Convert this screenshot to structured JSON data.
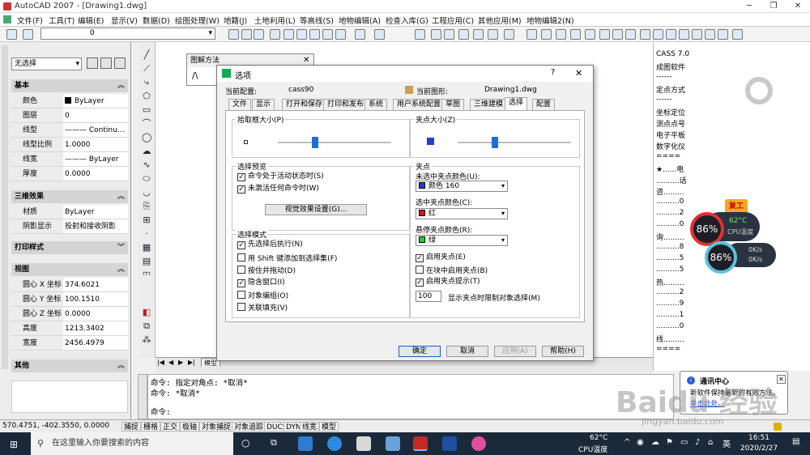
{
  "app": {
    "title": "AutoCAD 2007 - [Drawing1.dwg]"
  },
  "menu": [
    "文件(F)",
    "工具(T)",
    "编辑(E)",
    "显示(V)",
    "数据(D)",
    "绘图处理(W)",
    "地籍(J)",
    "土地利用(L)",
    "等高线(S)",
    "地物编辑(A)",
    "检查入库(G)",
    "工程应用(C)",
    "其他应用(M)",
    "地物编辑2(N)"
  ],
  "layer": {
    "value": "0"
  },
  "properties": {
    "selection": "无选择",
    "sections": {
      "basic": "基本",
      "threed": "三维效果",
      "print": "打印样式",
      "view": "视图",
      "other": "其他"
    },
    "basic_rows": [
      {
        "k": "颜色",
        "v": "ByLayer"
      },
      {
        "k": "图层",
        "v": "0"
      },
      {
        "k": "线型",
        "v": "——— Continu…"
      },
      {
        "k": "线型比例",
        "v": "1.0000"
      },
      {
        "k": "线宽",
        "v": "——— ByLayer"
      },
      {
        "k": "厚度",
        "v": "0.0000"
      }
    ],
    "threed_rows": [
      {
        "k": "材质",
        "v": "ByLayer"
      },
      {
        "k": "阴影显示",
        "v": "投射和接收阴影"
      }
    ],
    "view_rows": [
      {
        "k": "圆心 X 坐标",
        "v": "374.6021"
      },
      {
        "k": "圆心 Y 坐标",
        "v": "100.1510"
      },
      {
        "k": "圆心 Z 坐标",
        "v": "0.0000"
      },
      {
        "k": "高度",
        "v": "1213.3402"
      },
      {
        "k": "宽度",
        "v": "2456.4979"
      }
    ]
  },
  "tujie": {
    "title": "图解方法"
  },
  "dialog": {
    "title": "选项",
    "profile_label": "当前配置:",
    "profile": "cass90",
    "drawing_label": "当前图形:",
    "drawing": "Drawing1.dwg",
    "tabs": [
      "文件",
      "显示",
      "打开和保存",
      "打印和发布",
      "系统",
      "用户系统配置",
      "草图",
      "三维建模",
      "选择",
      "配置"
    ],
    "pickbox": {
      "title": "拾取框大小(P)",
      "level": 0.33
    },
    "gripsize": {
      "title": "夹点大小(Z)",
      "level": 0.33
    },
    "preview": {
      "title": "选择预览",
      "opt1": "命令处于活动状态时(S)",
      "opt2": "未激活任何命令时(W)",
      "button": "视觉效果设置(G)..."
    },
    "mode": {
      "title": "选择模式",
      "items": [
        {
          "label": "先选择后执行(N)",
          "checked": true
        },
        {
          "label": "用 Shift 键添加到选择集(F)",
          "checked": false
        },
        {
          "label": "按住并拖动(D)",
          "checked": false
        },
        {
          "label": "隐含窗口(I)",
          "checked": true
        },
        {
          "label": "对象编组(O)",
          "checked": false
        },
        {
          "label": "关联填充(V)",
          "checked": false
        }
      ]
    },
    "grips": {
      "title": "夹点",
      "unsel_label": "未选中夹点颜色(U):",
      "unsel": "颜色 160",
      "unsel_color": "#1f3fd0",
      "sel_label": "选中夹点颜色(C):",
      "sel": "红",
      "sel_color": "#e01010",
      "hover_label": "悬停夹点颜色(R):",
      "hover": "绿",
      "hover_color": "#20d020",
      "enable": "启用夹点(E)",
      "block": "在块中启用夹点(B)",
      "tips": "启用夹点提示(T)",
      "limit_value": "100",
      "limit_label": "显示夹点时限制对象选择(M)"
    },
    "buttons": {
      "ok": "确定",
      "cancel": "取消",
      "apply": "应用(A)",
      "help": "帮助(H)"
    }
  },
  "right_panel": {
    "header": "CASS 7.0",
    "items": [
      "成图软件",
      "------",
      "定点方式",
      "------",
      "坐标定位",
      "测点点号",
      "电子平板",
      "数字化仪",
      "====",
      "★......电",
      "..........话",
      "咨.........",
      "..........0",
      "..........2",
      "..........0",
      "询.........",
      "..........8",
      "..........5",
      "..........5",
      "热.........",
      "..........2",
      "..........9",
      "..........1",
      "..........0",
      "线.........",
      "===="
    ]
  },
  "widget": {
    "pct1": "86%",
    "temp": "62°C",
    "cpu": "CPU温度",
    "pct2": "86%",
    "up": "0K/s",
    "down": "0K/s",
    "badge": "复工"
  },
  "command": {
    "line1": "命令: 指定对角点: *取消*",
    "line2": "命令: *取消*",
    "line3": "命令:"
  },
  "tabs_bar": [
    "模型"
  ],
  "status": {
    "coords": "570.4751, -402.3550, 0.0000",
    "buttons": [
      "捕捉",
      "栅格",
      "正交",
      "极轴",
      "对象捕捉",
      "对象追踪",
      "DUCS",
      "DYN",
      "线宽",
      "模型"
    ]
  },
  "notification": {
    "title": "通讯中心",
    "body1": "新软件保持最新的有效方法。",
    "body2": "单击此处。"
  },
  "watermark": {
    "text": "Baidu 经验",
    "url": "jingyan.baidu.com"
  },
  "taskbar": {
    "search": "在这里输入你要搜索的内容",
    "temp": "62°C",
    "cpu": "CPU温度",
    "lang": "英",
    "time": "16:51",
    "date": "2020/2/27"
  }
}
